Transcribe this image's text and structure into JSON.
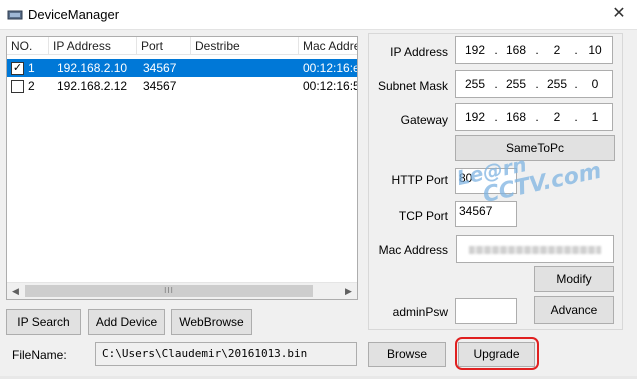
{
  "window": {
    "title": "DeviceManager",
    "close_glyph": "✕"
  },
  "table": {
    "columns": [
      "NO.",
      "IP Address",
      "Port",
      "Destribe",
      "Mac Addre"
    ],
    "rows": [
      {
        "checked": true,
        "no": "1",
        "ip": "192.168.2.10",
        "port": "34567",
        "describe": "",
        "mac": "00:12:16:e",
        "selected": true
      },
      {
        "checked": false,
        "no": "2",
        "ip": "192.168.2.12",
        "port": "34567",
        "describe": "",
        "mac": "00:12:16:5",
        "selected": false
      }
    ],
    "scroll_thumb_grip": "III"
  },
  "buttons": {
    "ip_search": "IP Search",
    "add_device": "Add Device",
    "web_browse": "WebBrowse",
    "same_to_pc": "SameToPc",
    "modify": "Modify",
    "advance": "Advance",
    "browse": "Browse",
    "upgrade": "Upgrade"
  },
  "form": {
    "ip_address_label": "IP Address",
    "ip_address": [
      "192",
      "168",
      "2",
      "10"
    ],
    "subnet_mask_label": "Subnet Mask",
    "subnet_mask": [
      "255",
      "255",
      "255",
      "0"
    ],
    "gateway_label": "Gateway",
    "gateway": [
      "192",
      "168",
      "2",
      "1"
    ],
    "http_port_label": "HTTP Port",
    "http_port": "80",
    "tcp_port_label": "TCP Port",
    "tcp_port": "34567",
    "mac_address_label": "Mac Address",
    "admin_psw_label": "adminPsw",
    "admin_psw": ""
  },
  "file": {
    "label": "FileName:",
    "path": "C:\\Users\\Claudemir\\20161013.bin"
  },
  "watermark": {
    "line1": "Le@rn",
    "line2": "CCTV.com"
  },
  "colors": {
    "selection": "#0078d7",
    "highlight_ring": "#e02020",
    "button_face": "#e1e1e1"
  }
}
